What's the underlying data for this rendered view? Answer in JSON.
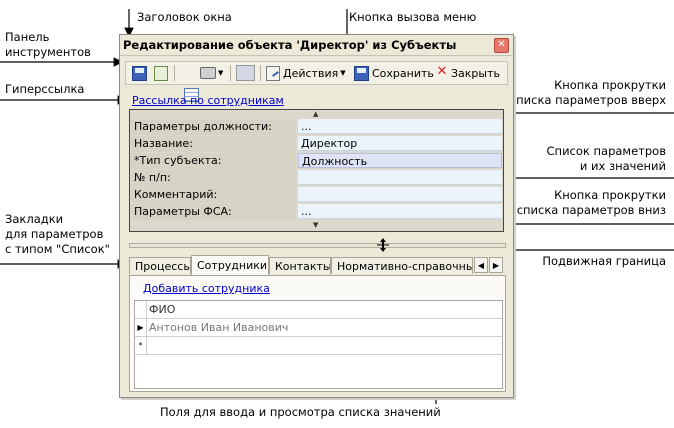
{
  "annotations": {
    "window_title": "Заголовок окна",
    "toolbar": "Панель\nинструментов",
    "hyperlink": "Гиперссылка",
    "tabs": "Закладки\nдля параметров\nс типом \"Список\"",
    "menu_button": "Кнопка вызова меню",
    "scroll_up": "Кнопка прокрутки\nсписка параметров вверх",
    "param_list": "Список параметров\nи их значений",
    "scroll_down": "Кнопка прокрутки\nсписка параметров вниз",
    "splitter": "Подвижная граница",
    "list_fields": "Поля для ввода и просмотра списка значений"
  },
  "window": {
    "title": "Редактирование объекта 'Директор' из Субъекты",
    "close_glyph": "✕"
  },
  "toolbar": {
    "actions_label": "Действия",
    "save_label": "Сохранить",
    "close_label": "Закрыть"
  },
  "hyperlink": "Рассылка по сотрудникам",
  "params": [
    {
      "label": "Параметры должности:",
      "value": "..."
    },
    {
      "label": "Название:",
      "value": "Директор"
    },
    {
      "label": "*Тип субъекта:",
      "value": "Должность"
    },
    {
      "label": "№ п/п:",
      "value": ""
    },
    {
      "label": "Комментарий:",
      "value": ""
    },
    {
      "label": "Параметры ФСА:",
      "value": "..."
    }
  ],
  "tabs": [
    "Процессы",
    "Сотрудники",
    "Контакты",
    "Нормативно-справочные д"
  ],
  "active_tab": "Сотрудники",
  "panel": {
    "add_link": "Добавить сотрудника",
    "column_header": "ФИО",
    "rows": [
      "Антонов Иван Иванович"
    ],
    "new_row_marker": "*"
  },
  "colors": {
    "link": "#0000cc",
    "window_bg": "#ece9d8",
    "value_bg": "#ecf4fb"
  }
}
